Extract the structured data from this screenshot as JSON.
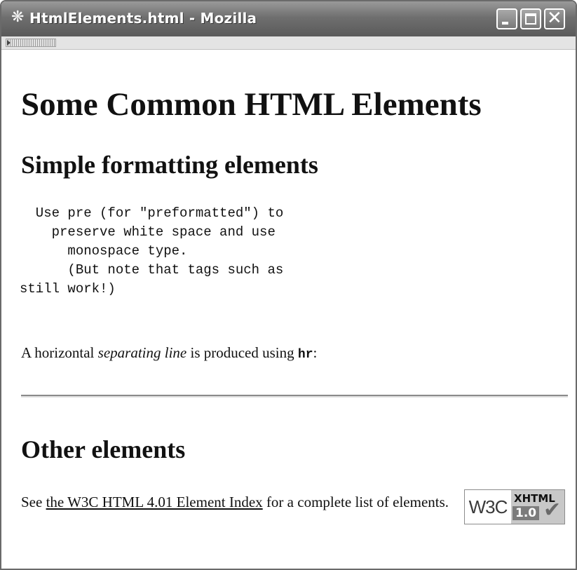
{
  "window": {
    "title": "HtmlElements.html - Mozilla",
    "app_icon": "mozilla-app-icon",
    "controls": {
      "minimize": "minimize-icon",
      "maximize": "maximize-icon",
      "close_glyph": "✕"
    }
  },
  "page": {
    "heading": "Some Common HTML Elements",
    "section1": {
      "heading": "Simple formatting elements",
      "pre_text": "  Use pre (for \"preformatted\") to\n    preserve white space and use\n      monospace type.\n      (But note that tags such as\nstill work!)",
      "separator_text": {
        "before": "A horizontal ",
        "emphasis": "separating line",
        "middle": " is produced using ",
        "code": "hr",
        "after": ":"
      }
    },
    "section2": {
      "heading": "Other elements",
      "see_text": {
        "before": "See ",
        "link": "the W3C HTML 4.01 Element Index",
        "after": " for a complete list of elements."
      }
    },
    "badge": {
      "logo": "W3C",
      "label": "XHTML",
      "version": "1.0",
      "check": "✔"
    }
  },
  "colors": {
    "titlebar": "#6f6f6f",
    "text": "#111111",
    "page_background": "#ffffff"
  }
}
